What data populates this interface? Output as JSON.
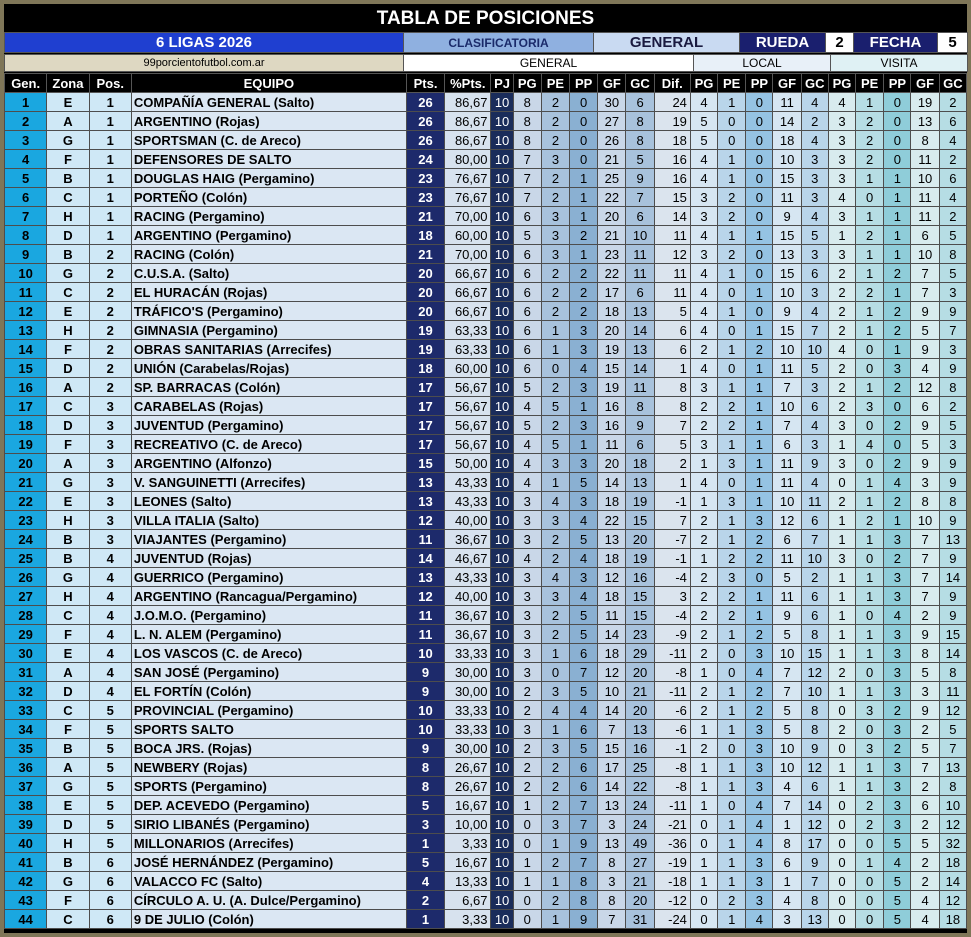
{
  "title": "TABLA DE POSICIONES",
  "header": {
    "league": "6 LIGAS 2026",
    "clasificatoria": "CLASIFICATORIA",
    "general": "GENERAL",
    "rueda_label": "RUEDA",
    "rueda_value": "2",
    "fecha_label": "FECHA",
    "fecha_value": "5",
    "site": "99porcientofutbol.com.ar",
    "sub_general": "GENERAL",
    "sub_local": "LOCAL",
    "sub_visita": "VISITA"
  },
  "columns": [
    "Gen.",
    "Zona",
    "Pos.",
    "EQUIPO",
    "Pts.",
    "%Pts.",
    "PJ",
    "PG",
    "PE",
    "PP",
    "GF",
    "GC",
    "Dif.",
    "PG",
    "PE",
    "PP",
    "GF",
    "GC",
    "PG",
    "PE",
    "PP",
    "GF",
    "GC"
  ],
  "colors": {
    "title_bg": "#000000",
    "league_bg": "#1f3fd0",
    "rueda_bg": "#1a1f6e",
    "gen_col": "#1aa7e0",
    "pts_col": "#1d2a6b"
  },
  "rows": [
    [
      "1",
      "E",
      "1",
      "COMPAÑÍA GENERAL (Salto)",
      "26",
      "86,67",
      "10",
      "8",
      "2",
      "0",
      "30",
      "6",
      "24",
      "4",
      "1",
      "0",
      "11",
      "4",
      "4",
      "1",
      "0",
      "19",
      "2"
    ],
    [
      "2",
      "A",
      "1",
      "ARGENTINO (Rojas)",
      "26",
      "86,67",
      "10",
      "8",
      "2",
      "0",
      "27",
      "8",
      "19",
      "5",
      "0",
      "0",
      "14",
      "2",
      "3",
      "2",
      "0",
      "13",
      "6"
    ],
    [
      "3",
      "G",
      "1",
      "SPORTSMAN (C. de Areco)",
      "26",
      "86,67",
      "10",
      "8",
      "2",
      "0",
      "26",
      "8",
      "18",
      "5",
      "0",
      "0",
      "18",
      "4",
      "3",
      "2",
      "0",
      "8",
      "4"
    ],
    [
      "4",
      "F",
      "1",
      "DEFENSORES DE SALTO",
      "24",
      "80,00",
      "10",
      "7",
      "3",
      "0",
      "21",
      "5",
      "16",
      "4",
      "1",
      "0",
      "10",
      "3",
      "3",
      "2",
      "0",
      "11",
      "2"
    ],
    [
      "5",
      "B",
      "1",
      "DOUGLAS HAIG (Pergamino)",
      "23",
      "76,67",
      "10",
      "7",
      "2",
      "1",
      "25",
      "9",
      "16",
      "4",
      "1",
      "0",
      "15",
      "3",
      "3",
      "1",
      "1",
      "10",
      "6"
    ],
    [
      "6",
      "C",
      "1",
      "PORTEÑO (Colón)",
      "23",
      "76,67",
      "10",
      "7",
      "2",
      "1",
      "22",
      "7",
      "15",
      "3",
      "2",
      "0",
      "11",
      "3",
      "4",
      "0",
      "1",
      "11",
      "4"
    ],
    [
      "7",
      "H",
      "1",
      "RACING (Pergamino)",
      "21",
      "70,00",
      "10",
      "6",
      "3",
      "1",
      "20",
      "6",
      "14",
      "3",
      "2",
      "0",
      "9",
      "4",
      "3",
      "1",
      "1",
      "11",
      "2"
    ],
    [
      "8",
      "D",
      "1",
      "ARGENTINO (Pergamino)",
      "18",
      "60,00",
      "10",
      "5",
      "3",
      "2",
      "21",
      "10",
      "11",
      "4",
      "1",
      "1",
      "15",
      "5",
      "1",
      "2",
      "1",
      "6",
      "5"
    ],
    [
      "9",
      "B",
      "2",
      "RACING (Colón)",
      "21",
      "70,00",
      "10",
      "6",
      "3",
      "1",
      "23",
      "11",
      "12",
      "3",
      "2",
      "0",
      "13",
      "3",
      "3",
      "1",
      "1",
      "10",
      "8"
    ],
    [
      "10",
      "G",
      "2",
      "C.U.S.A. (Salto)",
      "20",
      "66,67",
      "10",
      "6",
      "2",
      "2",
      "22",
      "11",
      "11",
      "4",
      "1",
      "0",
      "15",
      "6",
      "2",
      "1",
      "2",
      "7",
      "5"
    ],
    [
      "11",
      "C",
      "2",
      "EL HURACÁN (Rojas)",
      "20",
      "66,67",
      "10",
      "6",
      "2",
      "2",
      "17",
      "6",
      "11",
      "4",
      "0",
      "1",
      "10",
      "3",
      "2",
      "2",
      "1",
      "7",
      "3"
    ],
    [
      "12",
      "E",
      "2",
      "TRÁFICO'S (Pergamino)",
      "20",
      "66,67",
      "10",
      "6",
      "2",
      "2",
      "18",
      "13",
      "5",
      "4",
      "1",
      "0",
      "9",
      "4",
      "2",
      "1",
      "2",
      "9",
      "9"
    ],
    [
      "13",
      "H",
      "2",
      "GIMNASIA (Pergamino)",
      "19",
      "63,33",
      "10",
      "6",
      "1",
      "3",
      "20",
      "14",
      "6",
      "4",
      "0",
      "1",
      "15",
      "7",
      "2",
      "1",
      "2",
      "5",
      "7"
    ],
    [
      "14",
      "F",
      "2",
      "OBRAS SANITARIAS (Arrecifes)",
      "19",
      "63,33",
      "10",
      "6",
      "1",
      "3",
      "19",
      "13",
      "6",
      "2",
      "1",
      "2",
      "10",
      "10",
      "4",
      "0",
      "1",
      "9",
      "3"
    ],
    [
      "15",
      "D",
      "2",
      "UNIÓN (Carabelas/Rojas)",
      "18",
      "60,00",
      "10",
      "6",
      "0",
      "4",
      "15",
      "14",
      "1",
      "4",
      "0",
      "1",
      "11",
      "5",
      "2",
      "0",
      "3",
      "4",
      "9"
    ],
    [
      "16",
      "A",
      "2",
      "SP. BARRACAS (Colón)",
      "17",
      "56,67",
      "10",
      "5",
      "2",
      "3",
      "19",
      "11",
      "8",
      "3",
      "1",
      "1",
      "7",
      "3",
      "2",
      "1",
      "2",
      "12",
      "8"
    ],
    [
      "17",
      "C",
      "3",
      "CARABELAS (Rojas)",
      "17",
      "56,67",
      "10",
      "4",
      "5",
      "1",
      "16",
      "8",
      "8",
      "2",
      "2",
      "1",
      "10",
      "6",
      "2",
      "3",
      "0",
      "6",
      "2"
    ],
    [
      "18",
      "D",
      "3",
      "JUVENTUD (Pergamino)",
      "17",
      "56,67",
      "10",
      "5",
      "2",
      "3",
      "16",
      "9",
      "7",
      "2",
      "2",
      "1",
      "7",
      "4",
      "3",
      "0",
      "2",
      "9",
      "5"
    ],
    [
      "19",
      "F",
      "3",
      "RECREATIVO (C. de Areco)",
      "17",
      "56,67",
      "10",
      "4",
      "5",
      "1",
      "11",
      "6",
      "5",
      "3",
      "1",
      "1",
      "6",
      "3",
      "1",
      "4",
      "0",
      "5",
      "3"
    ],
    [
      "20",
      "A",
      "3",
      "ARGENTINO (Alfonzo)",
      "15",
      "50,00",
      "10",
      "4",
      "3",
      "3",
      "20",
      "18",
      "2",
      "1",
      "3",
      "1",
      "11",
      "9",
      "3",
      "0",
      "2",
      "9",
      "9"
    ],
    [
      "21",
      "G",
      "3",
      "V. SANGUINETTI (Arrecifes)",
      "13",
      "43,33",
      "10",
      "4",
      "1",
      "5",
      "14",
      "13",
      "1",
      "4",
      "0",
      "1",
      "11",
      "4",
      "0",
      "1",
      "4",
      "3",
      "9"
    ],
    [
      "22",
      "E",
      "3",
      "LEONES (Salto)",
      "13",
      "43,33",
      "10",
      "3",
      "4",
      "3",
      "18",
      "19",
      "-1",
      "1",
      "3",
      "1",
      "10",
      "11",
      "2",
      "1",
      "2",
      "8",
      "8"
    ],
    [
      "23",
      "H",
      "3",
      "VILLA ITALIA (Salto)",
      "12",
      "40,00",
      "10",
      "3",
      "3",
      "4",
      "22",
      "15",
      "7",
      "2",
      "1",
      "3",
      "12",
      "6",
      "1",
      "2",
      "1",
      "10",
      "9"
    ],
    [
      "24",
      "B",
      "3",
      "VIAJANTES (Pergamino)",
      "11",
      "36,67",
      "10",
      "3",
      "2",
      "5",
      "13",
      "20",
      "-7",
      "2",
      "1",
      "2",
      "6",
      "7",
      "1",
      "1",
      "3",
      "7",
      "13"
    ],
    [
      "25",
      "B",
      "4",
      "JUVENTUD (Rojas)",
      "14",
      "46,67",
      "10",
      "4",
      "2",
      "4",
      "18",
      "19",
      "-1",
      "1",
      "2",
      "2",
      "11",
      "10",
      "3",
      "0",
      "2",
      "7",
      "9"
    ],
    [
      "26",
      "G",
      "4",
      "GUERRICO (Pergamino)",
      "13",
      "43,33",
      "10",
      "3",
      "4",
      "3",
      "12",
      "16",
      "-4",
      "2",
      "3",
      "0",
      "5",
      "2",
      "1",
      "1",
      "3",
      "7",
      "14"
    ],
    [
      "27",
      "H",
      "4",
      "ARGENTINO (Rancagua/Pergamino)",
      "12",
      "40,00",
      "10",
      "3",
      "3",
      "4",
      "18",
      "15",
      "3",
      "2",
      "2",
      "1",
      "11",
      "6",
      "1",
      "1",
      "3",
      "7",
      "9"
    ],
    [
      "28",
      "C",
      "4",
      "J.O.M.O. (Pergamino)",
      "11",
      "36,67",
      "10",
      "3",
      "2",
      "5",
      "11",
      "15",
      "-4",
      "2",
      "2",
      "1",
      "9",
      "6",
      "1",
      "0",
      "4",
      "2",
      "9"
    ],
    [
      "29",
      "F",
      "4",
      "L. N. ALEM (Pergamino)",
      "11",
      "36,67",
      "10",
      "3",
      "2",
      "5",
      "14",
      "23",
      "-9",
      "2",
      "1",
      "2",
      "5",
      "8",
      "1",
      "1",
      "3",
      "9",
      "15"
    ],
    [
      "30",
      "E",
      "4",
      "LOS VASCOS (C. de Areco)",
      "10",
      "33,33",
      "10",
      "3",
      "1",
      "6",
      "18",
      "29",
      "-11",
      "2",
      "0",
      "3",
      "10",
      "15",
      "1",
      "1",
      "3",
      "8",
      "14"
    ],
    [
      "31",
      "A",
      "4",
      "SAN JOSÉ (Pergamino)",
      "9",
      "30,00",
      "10",
      "3",
      "0",
      "7",
      "12",
      "20",
      "-8",
      "1",
      "0",
      "4",
      "7",
      "12",
      "2",
      "0",
      "3",
      "5",
      "8"
    ],
    [
      "32",
      "D",
      "4",
      "EL FORTÍN (Colón)",
      "9",
      "30,00",
      "10",
      "2",
      "3",
      "5",
      "10",
      "21",
      "-11",
      "2",
      "1",
      "2",
      "7",
      "10",
      "1",
      "1",
      "3",
      "3",
      "11"
    ],
    [
      "33",
      "C",
      "5",
      "PROVINCIAL (Pergamino)",
      "10",
      "33,33",
      "10",
      "2",
      "4",
      "4",
      "14",
      "20",
      "-6",
      "2",
      "1",
      "2",
      "5",
      "8",
      "0",
      "3",
      "2",
      "9",
      "12"
    ],
    [
      "34",
      "F",
      "5",
      "SPORTS SALTO",
      "10",
      "33,33",
      "10",
      "3",
      "1",
      "6",
      "7",
      "13",
      "-6",
      "1",
      "1",
      "3",
      "5",
      "8",
      "2",
      "0",
      "3",
      "2",
      "5"
    ],
    [
      "35",
      "B",
      "5",
      "BOCA JRS. (Rojas)",
      "9",
      "30,00",
      "10",
      "2",
      "3",
      "5",
      "15",
      "16",
      "-1",
      "2",
      "0",
      "3",
      "10",
      "9",
      "0",
      "3",
      "2",
      "5",
      "7"
    ],
    [
      "36",
      "A",
      "5",
      "NEWBERY (Rojas)",
      "8",
      "26,67",
      "10",
      "2",
      "2",
      "6",
      "17",
      "25",
      "-8",
      "1",
      "1",
      "3",
      "10",
      "12",
      "1",
      "1",
      "3",
      "7",
      "13"
    ],
    [
      "37",
      "G",
      "5",
      "SPORTS (Pergamino)",
      "8",
      "26,67",
      "10",
      "2",
      "2",
      "6",
      "14",
      "22",
      "-8",
      "1",
      "1",
      "3",
      "4",
      "6",
      "1",
      "1",
      "3",
      "2",
      "8"
    ],
    [
      "38",
      "E",
      "5",
      "DEP. ACEVEDO (Pergamino)",
      "5",
      "16,67",
      "10",
      "1",
      "2",
      "7",
      "13",
      "24",
      "-11",
      "1",
      "0",
      "4",
      "7",
      "14",
      "0",
      "2",
      "3",
      "6",
      "10"
    ],
    [
      "39",
      "D",
      "5",
      "SIRIO LIBANÉS (Pergamino)",
      "3",
      "10,00",
      "10",
      "0",
      "3",
      "7",
      "3",
      "24",
      "-21",
      "0",
      "1",
      "4",
      "1",
      "12",
      "0",
      "2",
      "3",
      "2",
      "12"
    ],
    [
      "40",
      "H",
      "5",
      "MILLONARIOS (Arrecifes)",
      "1",
      "3,33",
      "10",
      "0",
      "1",
      "9",
      "13",
      "49",
      "-36",
      "0",
      "1",
      "4",
      "8",
      "17",
      "0",
      "0",
      "5",
      "5",
      "32"
    ],
    [
      "41",
      "B",
      "6",
      "JOSÉ HERNÁNDEZ (Pergamino)",
      "5",
      "16,67",
      "10",
      "1",
      "2",
      "7",
      "8",
      "27",
      "-19",
      "1",
      "1",
      "3",
      "6",
      "9",
      "0",
      "1",
      "4",
      "2",
      "18"
    ],
    [
      "42",
      "G",
      "6",
      "VALACCO FC (Salto)",
      "4",
      "13,33",
      "10",
      "1",
      "1",
      "8",
      "3",
      "21",
      "-18",
      "1",
      "1",
      "3",
      "1",
      "7",
      "0",
      "0",
      "5",
      "2",
      "14"
    ],
    [
      "43",
      "F",
      "6",
      "CÍRCULO A. U. (A. Dulce/Pergamino)",
      "2",
      "6,67",
      "10",
      "0",
      "2",
      "8",
      "8",
      "20",
      "-12",
      "0",
      "2",
      "3",
      "4",
      "8",
      "0",
      "0",
      "5",
      "4",
      "12"
    ],
    [
      "44",
      "C",
      "6",
      "9 DE JULIO (Colón)",
      "1",
      "3,33",
      "10",
      "0",
      "1",
      "9",
      "7",
      "31",
      "-24",
      "0",
      "1",
      "4",
      "3",
      "13",
      "0",
      "0",
      "5",
      "4",
      "18"
    ]
  ]
}
